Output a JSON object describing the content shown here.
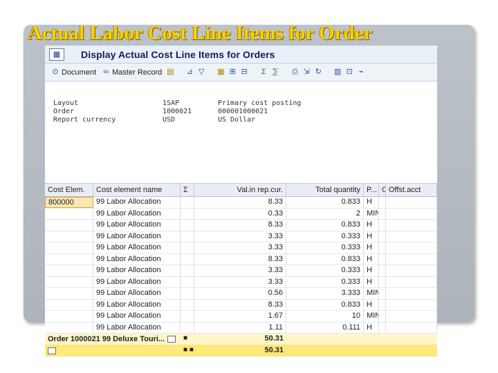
{
  "slide": {
    "title": "Actual Labor Cost Line Items for Order"
  },
  "window": {
    "title": "Display Actual Cost Line Items for Orders",
    "title_icon": "report-icon"
  },
  "toolbar": {
    "document_label": "Document",
    "master_record_label": "Master Record"
  },
  "header": {
    "rows": [
      {
        "label": "Layout",
        "value": "1SAP",
        "desc": "Primary cost posting"
      },
      {
        "label": "Order",
        "value": "1000021",
        "desc": "000001000021"
      },
      {
        "label": "Report currency",
        "value": "USD",
        "desc": "US Dollar"
      }
    ]
  },
  "grid": {
    "columns": [
      "Cost Elem.",
      "Cost element name",
      "Σ",
      "Val.in rep.cur.",
      "Total quantity",
      "P...",
      "O",
      "Offst.acct"
    ],
    "rows": [
      {
        "cost_elem": "800000",
        "name": "99 Labor Allocation",
        "value": "8.33",
        "qty": "0.833",
        "unit": "H"
      },
      {
        "cost_elem": "",
        "name": "99 Labor Allocation",
        "value": "0.33",
        "qty": "2",
        "unit": "MIN"
      },
      {
        "cost_elem": "",
        "name": "99 Labor Allocation",
        "value": "8.33",
        "qty": "0.833",
        "unit": "H"
      },
      {
        "cost_elem": "",
        "name": "99 Labor Allocation",
        "value": "3.33",
        "qty": "0.333",
        "unit": "H"
      },
      {
        "cost_elem": "",
        "name": "99 Labor Allocation",
        "value": "3.33",
        "qty": "0.333",
        "unit": "H"
      },
      {
        "cost_elem": "",
        "name": "99 Labor Allocation",
        "value": "8.33",
        "qty": "0.833",
        "unit": "H"
      },
      {
        "cost_elem": "",
        "name": "99 Labor Allocation",
        "value": "3.33",
        "qty": "0.333",
        "unit": "H"
      },
      {
        "cost_elem": "",
        "name": "99 Labor Allocation",
        "value": "3.33",
        "qty": "0.333",
        "unit": "H"
      },
      {
        "cost_elem": "",
        "name": "99 Labor Allocation",
        "value": "0.56",
        "qty": "3.333",
        "unit": "MIN"
      },
      {
        "cost_elem": "",
        "name": "99 Labor Allocation",
        "value": "8.33",
        "qty": "0.833",
        "unit": "H"
      },
      {
        "cost_elem": "",
        "name": "99 Labor Allocation",
        "value": "1.67",
        "qty": "10",
        "unit": "MIN"
      },
      {
        "cost_elem": "",
        "name": "99 Labor Allocation",
        "value": "1.11",
        "qty": "0.111",
        "unit": "H"
      }
    ],
    "subtotal": {
      "label": "Order 1000021 99 Deluxe Touri...",
      "dots": "■",
      "value": "50.31"
    },
    "total": {
      "label": "",
      "dots": "■ ■",
      "value": "50.31"
    }
  }
}
